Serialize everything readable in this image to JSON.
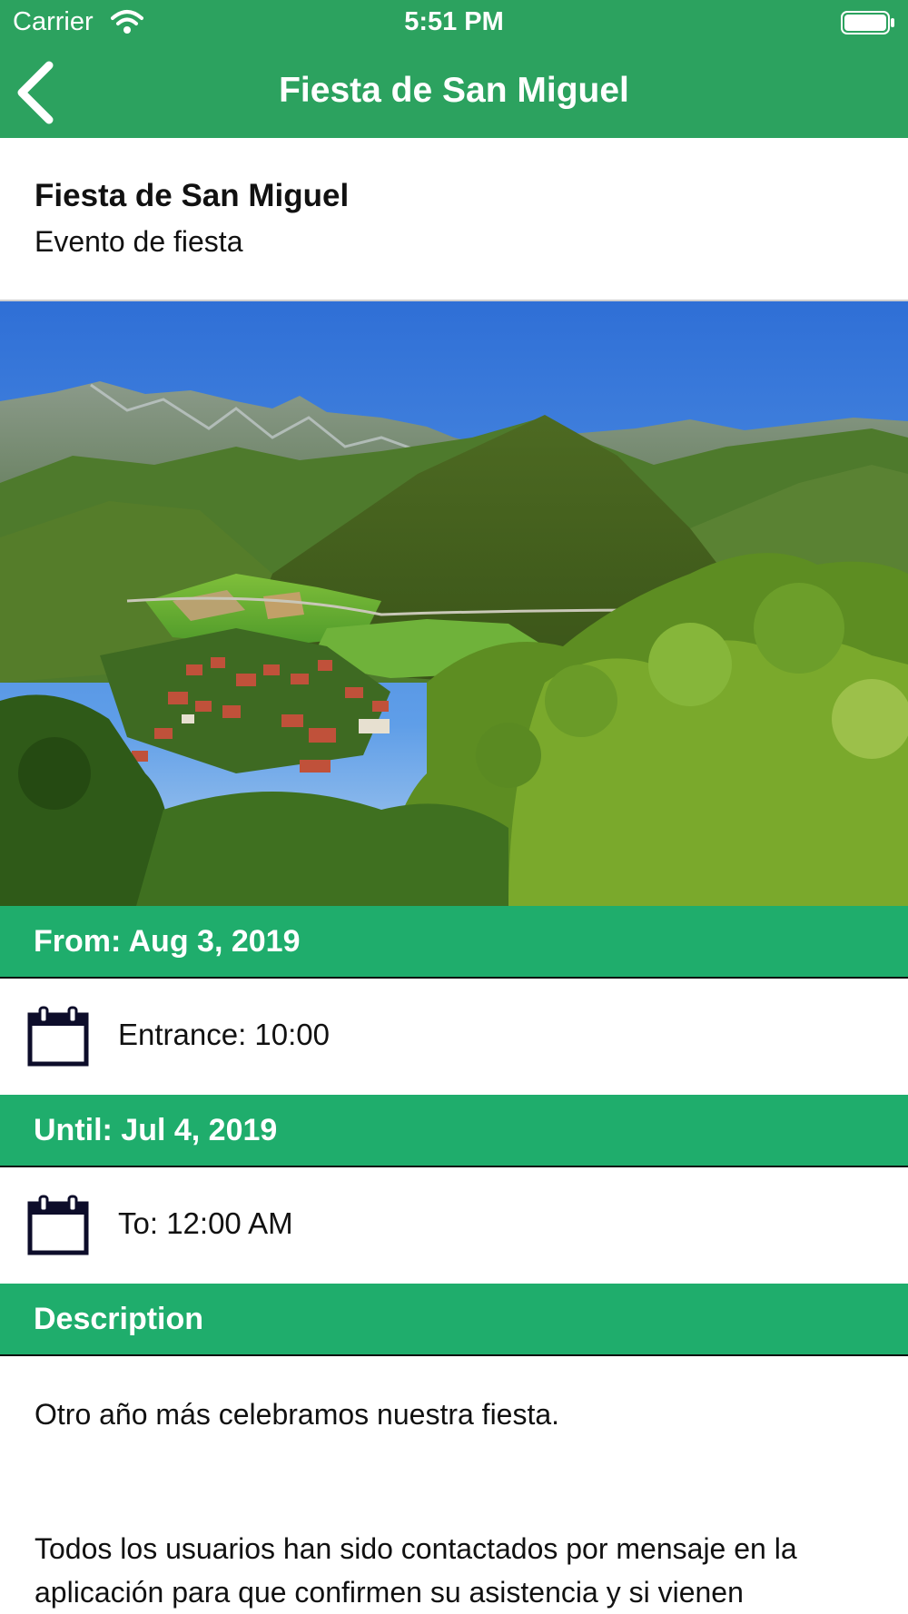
{
  "status_bar": {
    "carrier": "Carrier",
    "time": "5:51 PM"
  },
  "nav": {
    "title": "Fiesta de San Miguel"
  },
  "event": {
    "title": "Fiesta de San Miguel",
    "subtitle": "Evento de fiesta"
  },
  "hero": {
    "image_content": "mountain valley village landscape"
  },
  "from": {
    "label": "From: Aug 3, 2019",
    "time_text": "Entrance: 10:00"
  },
  "until": {
    "label": "Until: Jul 4, 2019",
    "time_text": "To: 12:00 AM"
  },
  "description": {
    "heading": "Description",
    "paragraph1": "Otro año más celebramos nuestra fiesta.",
    "paragraph2": "Todos los usuarios han sido contactados por mensaje en la aplicación para que confirmen su asistencia y si vienen"
  },
  "colors": {
    "nav": "#2ca25f",
    "section": "#1fad6c",
    "icon": "#0d0d2a"
  }
}
